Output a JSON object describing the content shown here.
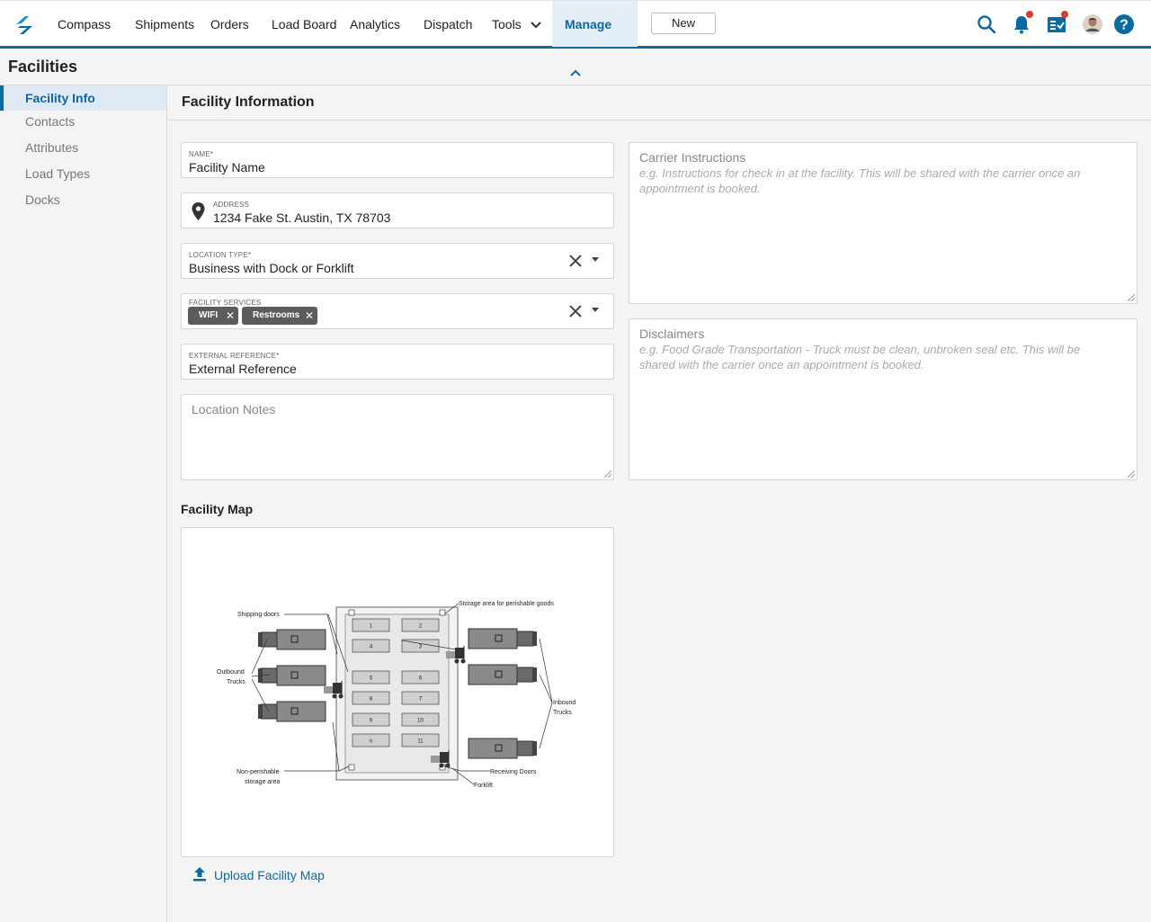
{
  "nav": {
    "logo_icon": "app-logo",
    "items": [
      {
        "label": "Compass"
      },
      {
        "label": "Shipments"
      },
      {
        "label": "Orders"
      },
      {
        "label": "Load Board"
      },
      {
        "label": "Analytics"
      },
      {
        "label": "Dispatch"
      },
      {
        "label": "Tools"
      },
      {
        "label": "Manage"
      }
    ],
    "new_label": "New",
    "icons": [
      "search-icon",
      "bell-icon",
      "tasks-icon",
      "avatar",
      "help-icon"
    ],
    "accent": "#0b6aa2",
    "badge_color": "#d93a32"
  },
  "page": {
    "title": "Facilities"
  },
  "sidebar": {
    "items": [
      {
        "label": "Facility Info"
      },
      {
        "label": "Contacts"
      },
      {
        "label": "Attributes"
      },
      {
        "label": "Load Types"
      },
      {
        "label": "Docks"
      }
    ]
  },
  "section": {
    "title": "Facility Information"
  },
  "form": {
    "name": {
      "label": "NAME*",
      "value": "Facility Name"
    },
    "address": {
      "label": "ADDRESS",
      "value": "1234 Fake St. Austin, TX 78703"
    },
    "location_type": {
      "label": "LOCATION TYPE*",
      "value": "Business with Dock or Forklift"
    },
    "services": {
      "label": "FACILITY SERVICES",
      "chips": [
        "WIFI",
        "Restrooms"
      ]
    },
    "external_reference": {
      "label": "EXTERNAL REFERENCE*",
      "value": "External Reference"
    },
    "location_notes": {
      "placeholder": "Location Notes"
    },
    "carrier_instructions": {
      "title": "Carrier Instructions",
      "placeholder": "e.g. Instructions for check in at the facility. This will be shared with the carrier once an appointment is booked."
    },
    "disclaimers": {
      "title": "Disclaimers",
      "placeholder": "e.g. Food Grade Transportation - Truck must be clean, unbroken seal etc. This will be shared with the carrier once an appointment is booked."
    }
  },
  "map": {
    "title": "Facility Map",
    "upload_label": "Upload Facility Map",
    "diagram": {
      "labels": {
        "shipping_doors": "Shipping doors",
        "storage_perishable": "Storage area for perishable goods",
        "outbound_1": "Outbound",
        "outbound_2": "Trucks",
        "inbound_1": "Inbound",
        "inbound_2": "Trucks",
        "non_perishable_1": "Non-perishable",
        "non_perishable_2": "storage area",
        "receiving_doors": "Receiving Doors",
        "forklift": "Forklift"
      },
      "bays": [
        "1",
        "2",
        "4",
        "3",
        "5",
        "6",
        "8",
        "7",
        "9",
        "10",
        "n",
        "11"
      ]
    }
  }
}
